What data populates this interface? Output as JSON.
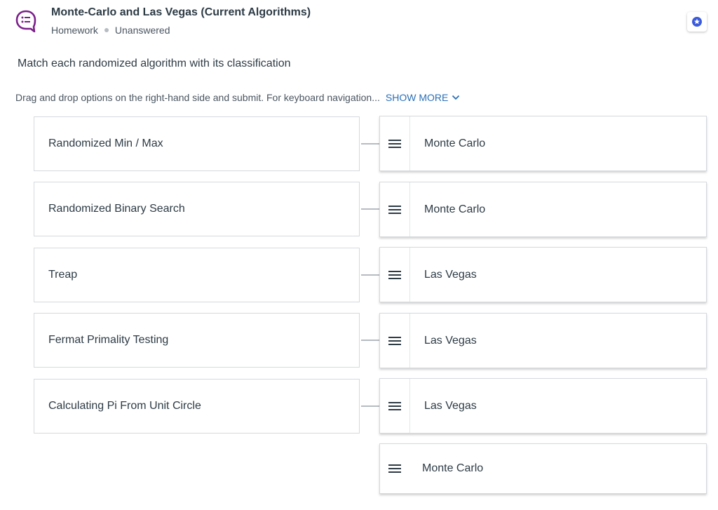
{
  "header": {
    "title": "Monte-Carlo and Las Vegas (Current Algorithms)",
    "type": "Homework",
    "status": "Unanswered"
  },
  "question": {
    "prompt": "Match each randomized algorithm with its classification",
    "instructions": "Drag and drop options on the right-hand side and submit. For keyboard navigation...",
    "show_more": "SHOW MORE"
  },
  "rows": [
    {
      "item": "Randomized Min / Max",
      "answer": "Monte Carlo"
    },
    {
      "item": "Randomized Binary Search",
      "answer": "Monte Carlo"
    },
    {
      "item": "Treap",
      "answer": "Las Vegas"
    },
    {
      "item": "Fermat Primality Testing",
      "answer": "Las Vegas"
    },
    {
      "item": "Calculating Pi From Unit Circle",
      "answer": "Las Vegas"
    }
  ],
  "spare_option": "Monte Carlo",
  "colors": {
    "accent_purple": "#7b1f8a",
    "link_blue": "#2a6fb8",
    "flag_blue": "#3b5bdb"
  },
  "icons": {
    "question": "speech-bubble-list-icon",
    "flag": "star-badge-icon",
    "handle": "drag-handle-icon",
    "chevron": "chevron-down-icon"
  }
}
